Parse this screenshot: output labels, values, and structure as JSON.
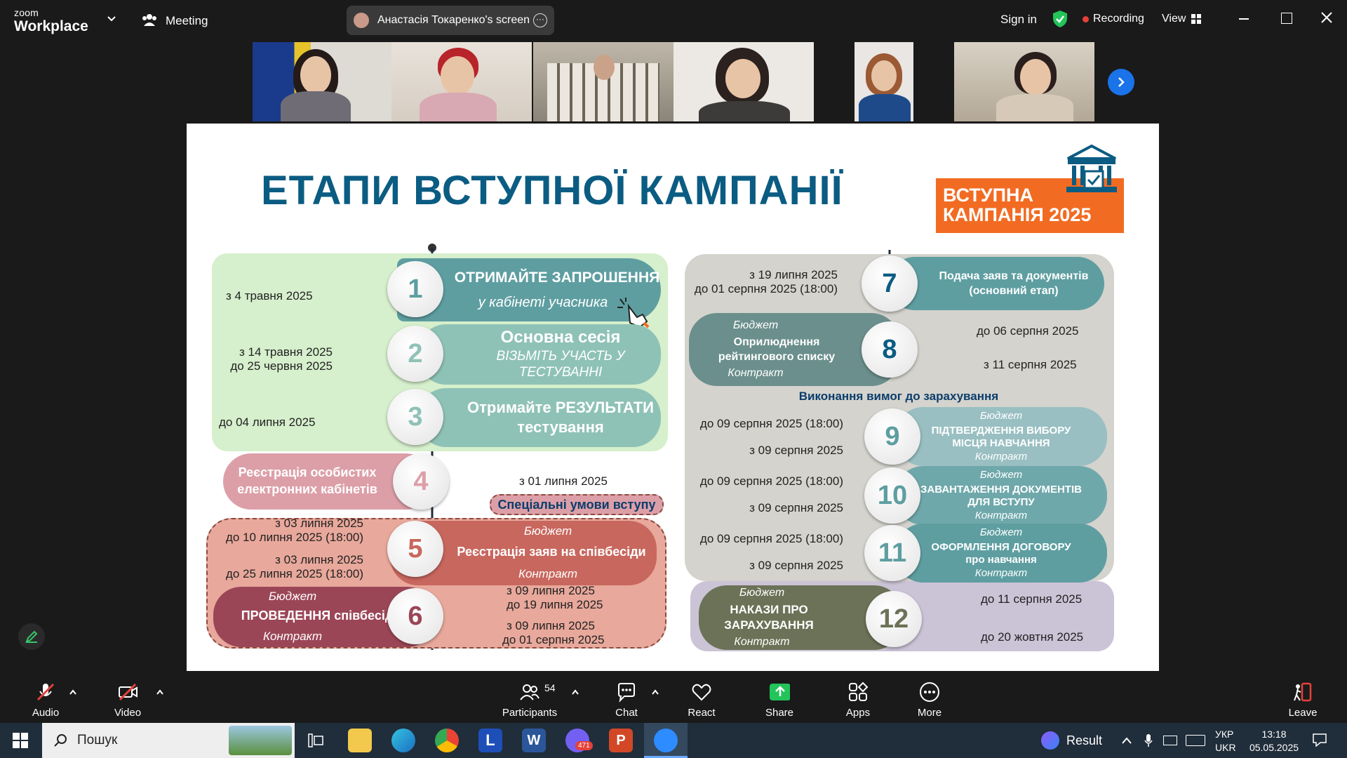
{
  "window": {
    "brand_small": "zoom",
    "brand_big": "Workplace",
    "meeting_label": "Meeting",
    "share_label": "Анастасія Токаренко's screen",
    "sign_in": "Sign in",
    "recording": "Recording",
    "view": "View"
  },
  "colors": {
    "accent": "#0b5c82",
    "orange": "#f26b22",
    "green_panel": "#d6efcc",
    "teal": "#5e9ea1",
    "mint": "#8fc2b6",
    "red_panel": "#e8a89b",
    "pink": "#dc9fa8",
    "burgundy": "#9b4657",
    "grey_panel": "#d4d3cd",
    "olive": "#6b7257",
    "lavender": "#cbc3d6"
  },
  "slide": {
    "title": "ЕТАПИ ВСТУПНОЇ КАМПАНІЇ",
    "badge_line1": "ВСТУПНА",
    "badge_line2": "КАМПАНІЯ 2025",
    "steps": {
      "s1": {
        "num": "1",
        "title": "ОТРИМАЙТЕ ЗАПРОШЕННЯ",
        "sub": "у кабінеті учасника",
        "date": "з 4 травня 2025"
      },
      "s2": {
        "num": "2",
        "title": "Основна сесія",
        "sub1": "ВІЗЬМІТЬ УЧАСТЬ У",
        "sub2": "ТЕСТУВАННІ",
        "date1": "з 14 травня 2025",
        "date2": "до 25 червня 2025"
      },
      "s3": {
        "num": "3",
        "title1": "Отримайте РЕЗУЛЬТАТИ",
        "title2": "тестування",
        "date": "до 04 липня 2025"
      },
      "s4": {
        "num": "4",
        "title1": "Реєстрація особистих",
        "title2": "електронних кабінетів",
        "date": "з 01 липня 2025"
      },
      "special": "Спеціальні умови вступу",
      "s5": {
        "num": "5",
        "title": "Реєстрація заяв на співбесіди",
        "budget": "Бюджет",
        "contract": "Контракт",
        "d1a": "з 03 липня 2025",
        "d1b": "до 10 липня 2025 (18:00)",
        "d2a": "з 03 липня 2025",
        "d2b": "до 25 липня 2025 (18:00)"
      },
      "s6": {
        "num": "6",
        "title": "ПРОВЕДЕННЯ співбесід",
        "budget": "Бюджет",
        "contract": "Контракт",
        "d1a": "з 09 липня 2025",
        "d1b": "до 19 липня 2025",
        "d2a": "з 09 липня 2025",
        "d2b": "до 01 серпня 2025"
      },
      "s7": {
        "num": "7",
        "title1": "Подача заяв та документів",
        "title2": "(основний етап)",
        "d1": "з 19 липня 2025",
        "d2": "до 01 серпня 2025 (18:00)"
      },
      "s8": {
        "num": "8",
        "budget": "Бюджет",
        "title1": "Оприлюднення",
        "title2": "рейтингового списку",
        "contract": "Контракт",
        "d1": "до 06 серпня 2025",
        "d2": "з 11 серпня 2025"
      },
      "requirements": "Виконання вимог до зарахування",
      "s9": {
        "num": "9",
        "budget": "Бюджет",
        "title1": "ПІДТВЕРДЖЕННЯ ВИБОРУ",
        "title2": "МІСЦЯ  НАВЧАННЯ",
        "contract": "Контракт",
        "d1": "до 09 серпня 2025 (18:00)",
        "d2": "з 09 серпня 2025"
      },
      "s10": {
        "num": "10",
        "budget": "Бюджет",
        "title1": "ЗАВАНТАЖЕННЯ ДОКУМЕНТІВ",
        "title2": "ДЛЯ ВСТУПУ",
        "contract": "Контракт",
        "d1": "до 09 серпня 2025 (18:00)",
        "d2": "з 09 серпня 2025"
      },
      "s11": {
        "num": "11",
        "budget": "Бюджет",
        "title1": "ОФОРМЛЕННЯ ДОГОВОРУ",
        "title2": "про навчання",
        "contract": "Контракт",
        "d1": "до 09 серпня 2025 (18:00)",
        "d2": "з 09 серпня 2025"
      },
      "s12": {
        "num": "12",
        "budget": "Бюджет",
        "title1": "НАКАЗИ ПРО",
        "title2": "ЗАРАХУВАННЯ",
        "contract": "Контракт",
        "d1": "до 11 серпня 2025",
        "d2": "до 20 жовтня 2025"
      }
    }
  },
  "toolbar": {
    "audio": "Audio",
    "video": "Video",
    "participants": "Participants",
    "participants_count": "54",
    "chat": "Chat",
    "react": "React",
    "share": "Share",
    "apps": "Apps",
    "more": "More",
    "leave": "Leave"
  },
  "taskbar": {
    "search": "Пошук",
    "result": "Result",
    "lang1": "УКР",
    "lang2": "UKR",
    "time": "13:18",
    "date": "05.05.2025",
    "badge": "471"
  }
}
